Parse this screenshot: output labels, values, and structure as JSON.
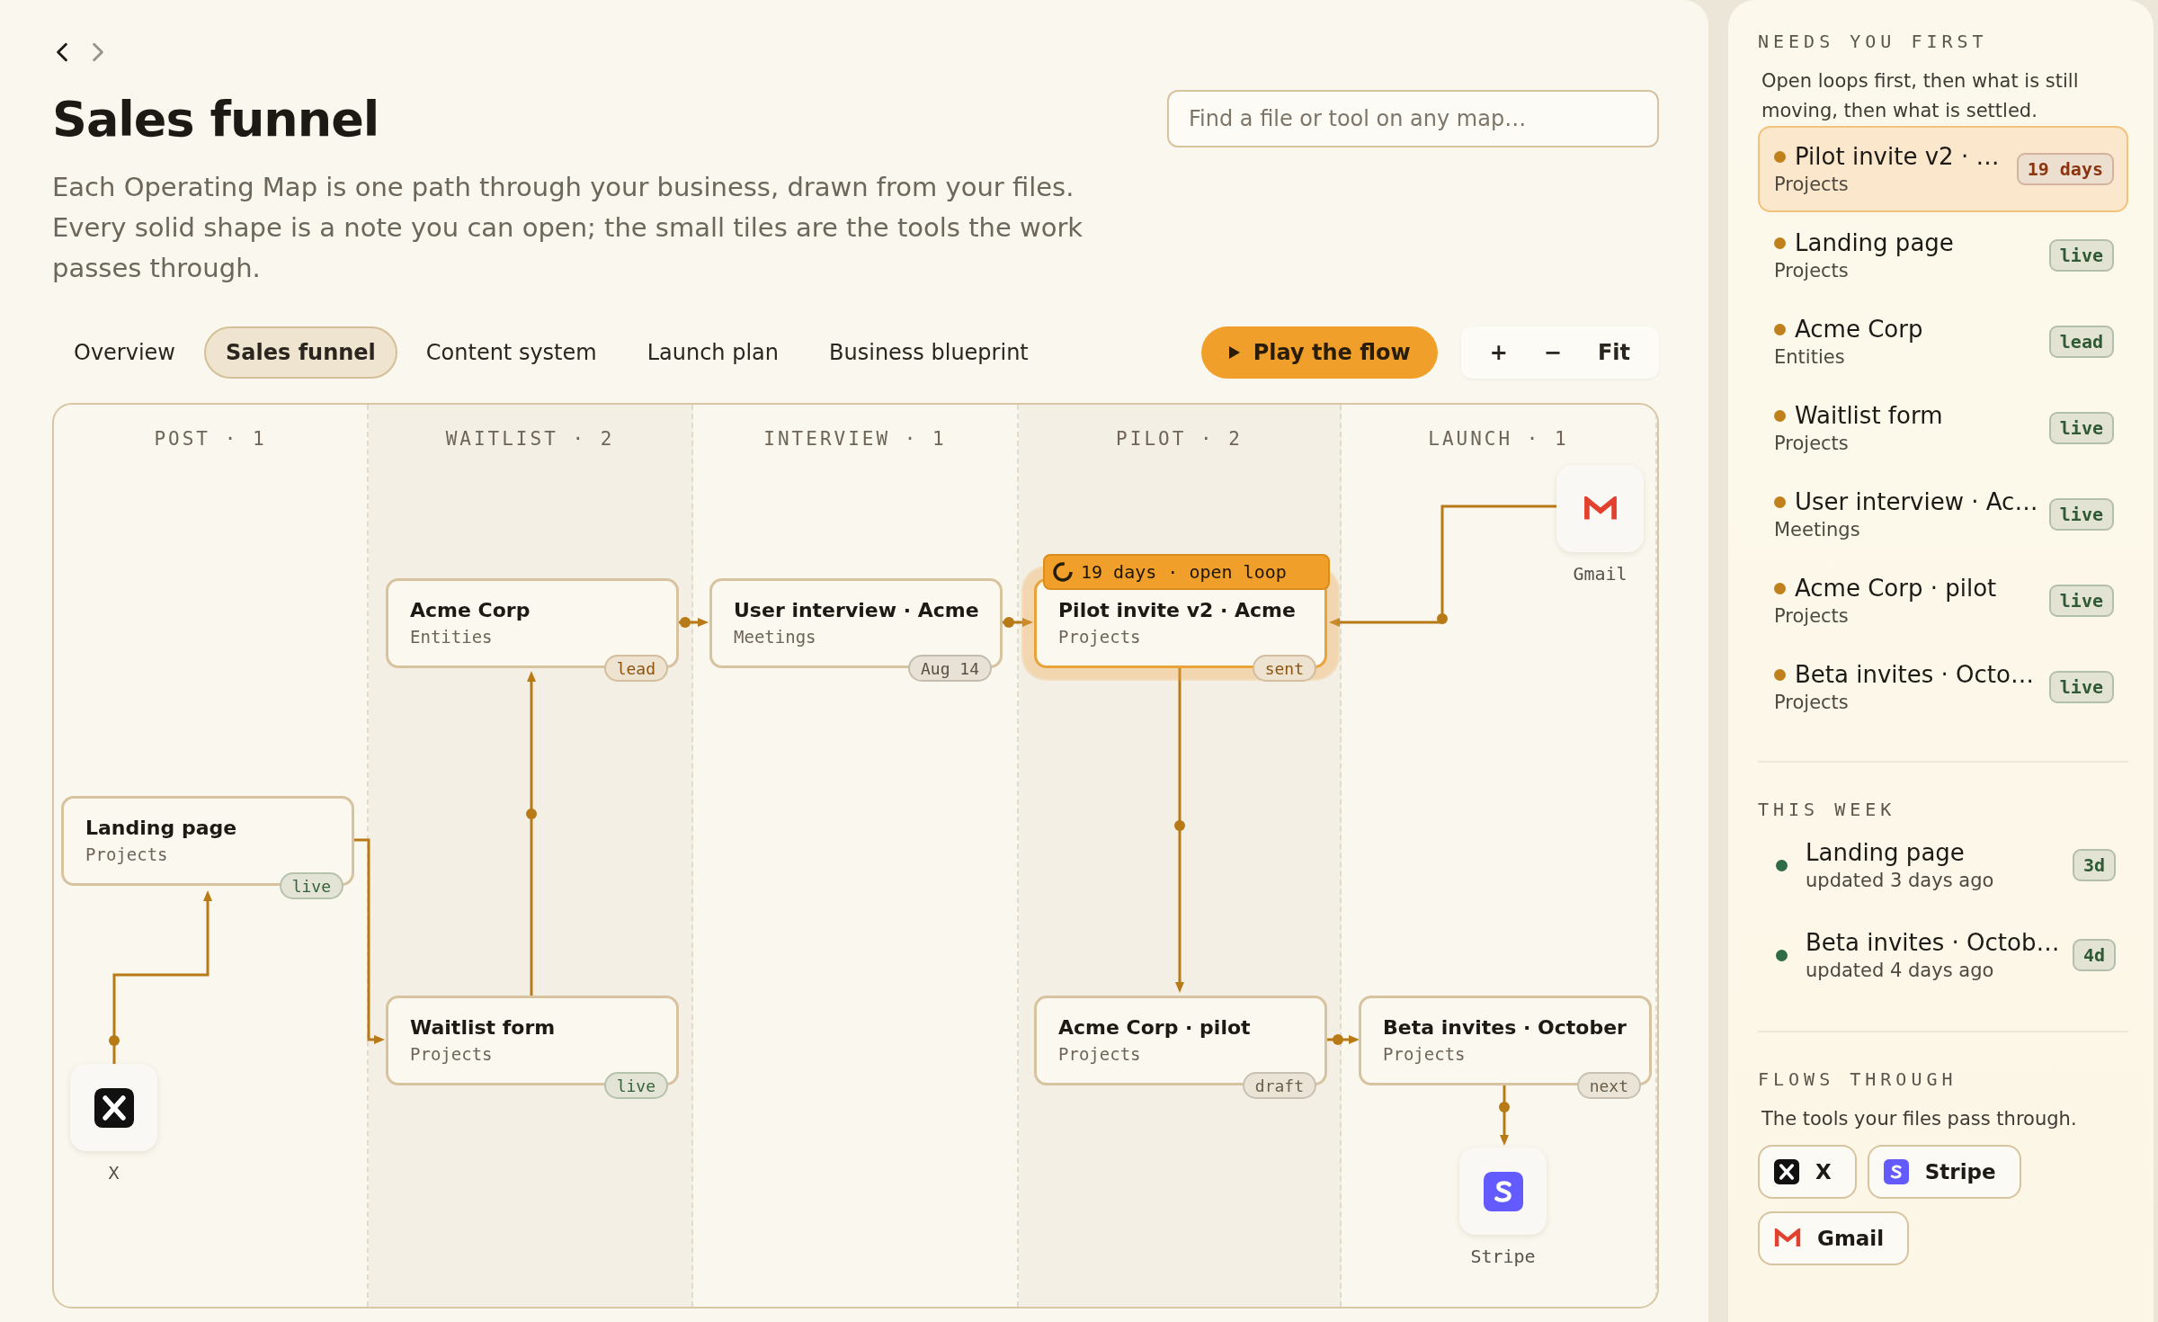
{
  "nav": [
    {
      "kind": "back",
      "disabled": false
    },
    {
      "kind": "forward",
      "disabled": true
    }
  ],
  "title": "Sales funnel",
  "search": {
    "placeholder": "Find a file or tool on any map…"
  },
  "description": "Each Operating Map is one path through your business, drawn from your files. Every solid shape is a note you can open; the small tiles are the tools the work passes through.",
  "tabs": [
    {
      "label": "Overview",
      "selected": false
    },
    {
      "label": "Sales funnel",
      "selected": true
    },
    {
      "label": "Content system",
      "selected": false
    },
    {
      "label": "Launch plan",
      "selected": false
    },
    {
      "label": "Business blueprint",
      "selected": false
    }
  ],
  "play": {
    "label": "Play the flow"
  },
  "zoom": [
    "+",
    "−",
    "Fit"
  ],
  "canvas": {
    "stages": [
      "POST · 1",
      "WAITLIST · 2",
      "INTERVIEW · 1",
      "PILOT · 2",
      "LAUNCH · 1"
    ],
    "nodes": [
      {
        "title": "Acme Corp",
        "folder": "Entities",
        "tag": {
          "text": "lead",
          "color": "#8a5410"
        }
      },
      {
        "title": "User interview · Acme",
        "folder": "Meetings",
        "tag": {
          "text": "Aug 14",
          "color": "#5a4f40"
        }
      },
      {
        "title": "Pilot invite v2 · Acme",
        "folder": "Projects",
        "tag": {
          "text": "sent",
          "color": "#8a5410"
        },
        "flag": "19 days · open loop"
      },
      {
        "title": "Landing page",
        "folder": "Projects",
        "tag": {
          "text": "live",
          "color": "#35613a"
        }
      },
      {
        "title": "Waitlist form",
        "folder": "Projects",
        "tag": {
          "text": "live",
          "color": "#35613a"
        }
      },
      {
        "title": "Acme Corp · pilot",
        "folder": "Projects",
        "tag": {
          "text": "draft",
          "color": "#6a5d49"
        }
      },
      {
        "title": "Beta invites · October",
        "folder": "Projects",
        "tag": {
          "text": "next",
          "color": "#6a5d49"
        }
      }
    ],
    "tools": [
      {
        "kind": "gmail",
        "label": "Gmail"
      },
      {
        "kind": "x",
        "label": "X"
      },
      {
        "kind": "stripe",
        "label": "Stripe"
      }
    ]
  },
  "sidebar": [
    {
      "kind": "queue",
      "heading": "NEEDS YOU FIRST",
      "note": "Open loops first, then what is still moving, then what is settled.",
      "items": [
        {
          "title": "Pilot invite v2 · …",
          "subtitle": "Projects",
          "tag": {
            "text": "19 days",
            "color": "#8a3510"
          },
          "selected": true,
          "color": "#c0801c"
        },
        {
          "title": "Landing page",
          "subtitle": "Projects",
          "tag": {
            "text": "live",
            "color": "#2f5a35"
          },
          "selected": false,
          "color": "#c0801c"
        },
        {
          "title": "Acme Corp",
          "subtitle": "Entities",
          "tag": {
            "text": "lead",
            "color": "#2f5a35"
          },
          "selected": false,
          "color": "#c0801c"
        },
        {
          "title": "Waitlist form",
          "subtitle": "Projects",
          "tag": {
            "text": "live",
            "color": "#2f5a35"
          },
          "selected": false,
          "color": "#c0801c"
        },
        {
          "title": "User interview · Ac…",
          "subtitle": "Meetings",
          "tag": {
            "text": "live",
            "color": "#2f5a35"
          },
          "selected": false,
          "color": "#c0801c"
        },
        {
          "title": "Acme Corp · pilot",
          "subtitle": "Projects",
          "tag": {
            "text": "live",
            "color": "#2f5a35"
          },
          "selected": false,
          "color": "#c0801c"
        },
        {
          "title": "Beta invites · Octo…",
          "subtitle": "Projects",
          "tag": {
            "text": "live",
            "color": "#2f5a35"
          },
          "selected": false,
          "color": "#c0801c"
        }
      ]
    },
    {
      "kind": "recent",
      "heading": "THIS WEEK",
      "items": [
        {
          "title": "Landing page",
          "subtitle": "updated 3 days ago",
          "tag": {
            "text": "3d",
            "color": "#2f5a35"
          },
          "color": "#2f6b45"
        },
        {
          "title": "Beta invites · Octob…",
          "subtitle": "updated 4 days ago",
          "tag": {
            "text": "4d",
            "color": "#2f5a35"
          },
          "color": "#2f6b45"
        }
      ]
    },
    {
      "kind": "tools",
      "heading": "FLOWS THROUGH",
      "note": "The tools your files pass through.",
      "chips": [
        {
          "kind": "x",
          "label": "X"
        },
        {
          "kind": "stripe",
          "label": "Stripe"
        },
        {
          "kind": "gmail",
          "label": "Gmail"
        }
      ]
    }
  ]
}
